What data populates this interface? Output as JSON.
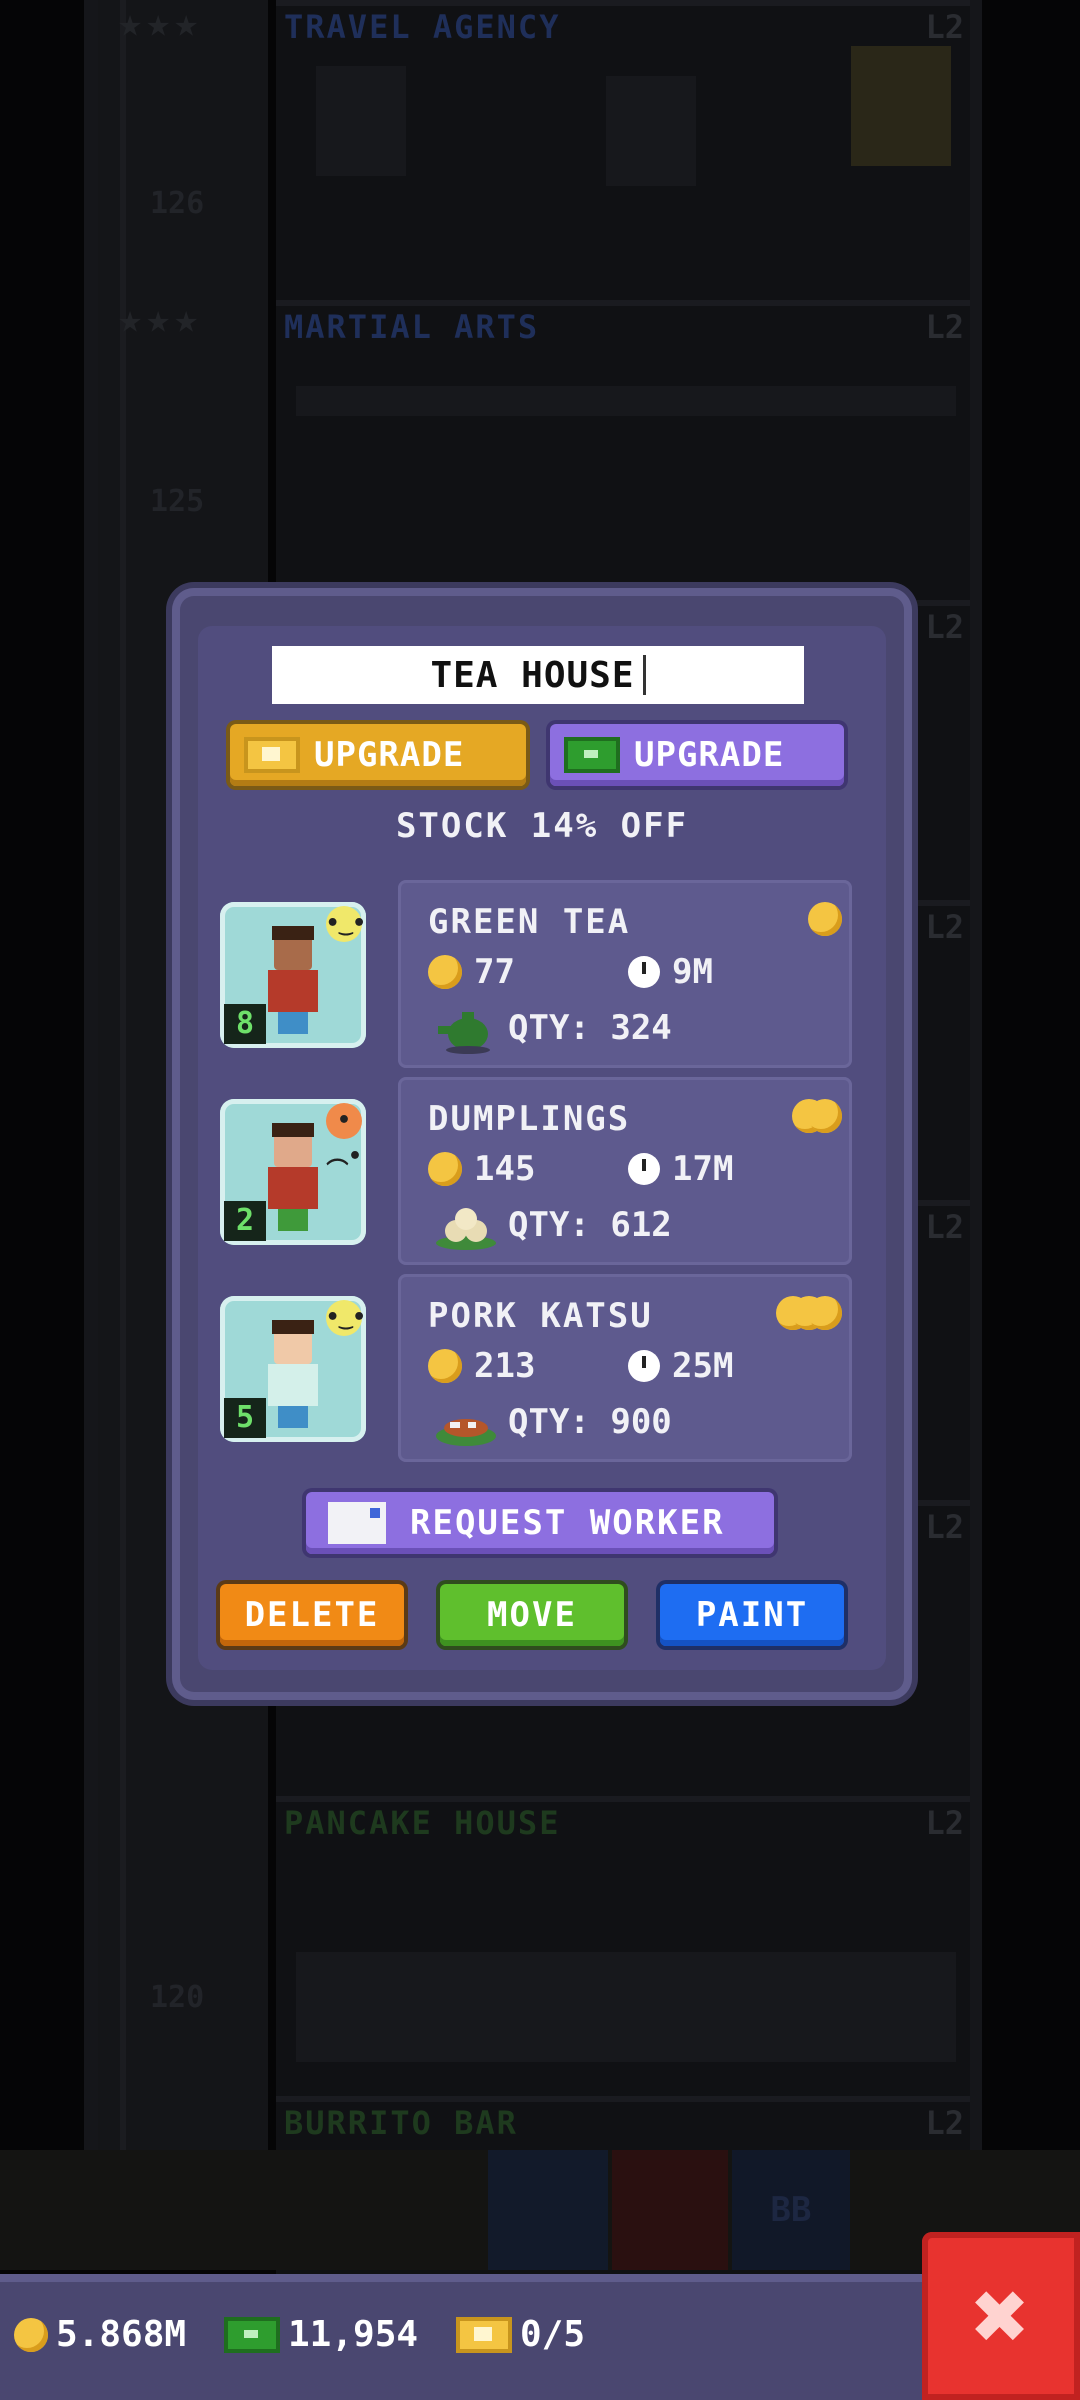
{
  "background": {
    "floors": [
      {
        "label": "TRAVEL AGENCY",
        "level": "L2",
        "number": "126",
        "label_color": "#1f2f5a"
      },
      {
        "label": "MARTIAL ARTS",
        "level": "L2",
        "number": "125",
        "label_color": "#1f2f5a"
      },
      {
        "label": "",
        "level": "L2",
        "number": "",
        "label_color": "#1f2f5a"
      },
      {
        "label": "",
        "level": "L2",
        "number": "",
        "label_color": "#1f2f5a"
      },
      {
        "label": "",
        "level": "L2",
        "number": "",
        "label_color": "#1f2f5a"
      },
      {
        "label": "",
        "level": "L2",
        "number": "",
        "label_color": "#1f2f5a"
      },
      {
        "label": "PANCAKE HOUSE",
        "level": "L2",
        "number": "120",
        "label_color": "#1e3a1e"
      },
      {
        "label": "BURRITO BAR",
        "level": "L2",
        "number": "",
        "label_color": "#1e3a1e"
      }
    ],
    "bottom_button_labels": {
      "bb": "BB"
    }
  },
  "dialog": {
    "floor_name": "TEA HOUSE",
    "upgrade_gold_label": "UPGRADE",
    "upgrade_bux_label": "UPGRADE",
    "stock_text": "STOCK 14% OFF",
    "workers": [
      {
        "level": "8",
        "mood": "neutral",
        "mood_glyph": "•‿•",
        "mood_color": "#f0e86a",
        "skin": "#a86b4a",
        "shirt": "#b53a2a",
        "legs": "#3f8ec7"
      },
      {
        "level": "2",
        "mood": "unhappy",
        "mood_glyph": "•︵•",
        "mood_color": "#f08a4a",
        "skin": "#e0a98a",
        "shirt": "#b53a2a",
        "legs": "#3f9a3a"
      },
      {
        "level": "5",
        "mood": "neutral",
        "mood_glyph": "•‿•",
        "mood_color": "#f0e86a",
        "skin": "#f0c9a8",
        "shirt": "#d4f0ea",
        "legs": "#3f8ec7"
      }
    ],
    "products": [
      {
        "name": "GREEN TEA",
        "price": "77",
        "time": "9M",
        "qty": "QTY: 324",
        "tier": 1,
        "food_icon": "teapot-icon"
      },
      {
        "name": "DUMPLINGS",
        "price": "145",
        "time": "17M",
        "qty": "QTY: 612",
        "tier": 2,
        "food_icon": "dumplings-icon"
      },
      {
        "name": "PORK KATSU",
        "price": "213",
        "time": "25M",
        "qty": "QTY: 900",
        "tier": 3,
        "food_icon": "katsu-icon"
      }
    ],
    "request_worker_label": "REQUEST WORKER",
    "delete_label": "DELETE",
    "move_label": "MOVE",
    "paint_label": "PAINT"
  },
  "status": {
    "coins": "5.868M",
    "bux": "11,954",
    "tickets": "0/5"
  },
  "colors": {
    "dialog_bg": "#4a4770",
    "upgrade_gold": "#e5a824",
    "upgrade_bux": "#8d6fe0",
    "delete": "#f18a15",
    "move": "#5fbf2d",
    "paint": "#1e6df2",
    "close": "#e8332f",
    "coin": "#f4c542"
  }
}
